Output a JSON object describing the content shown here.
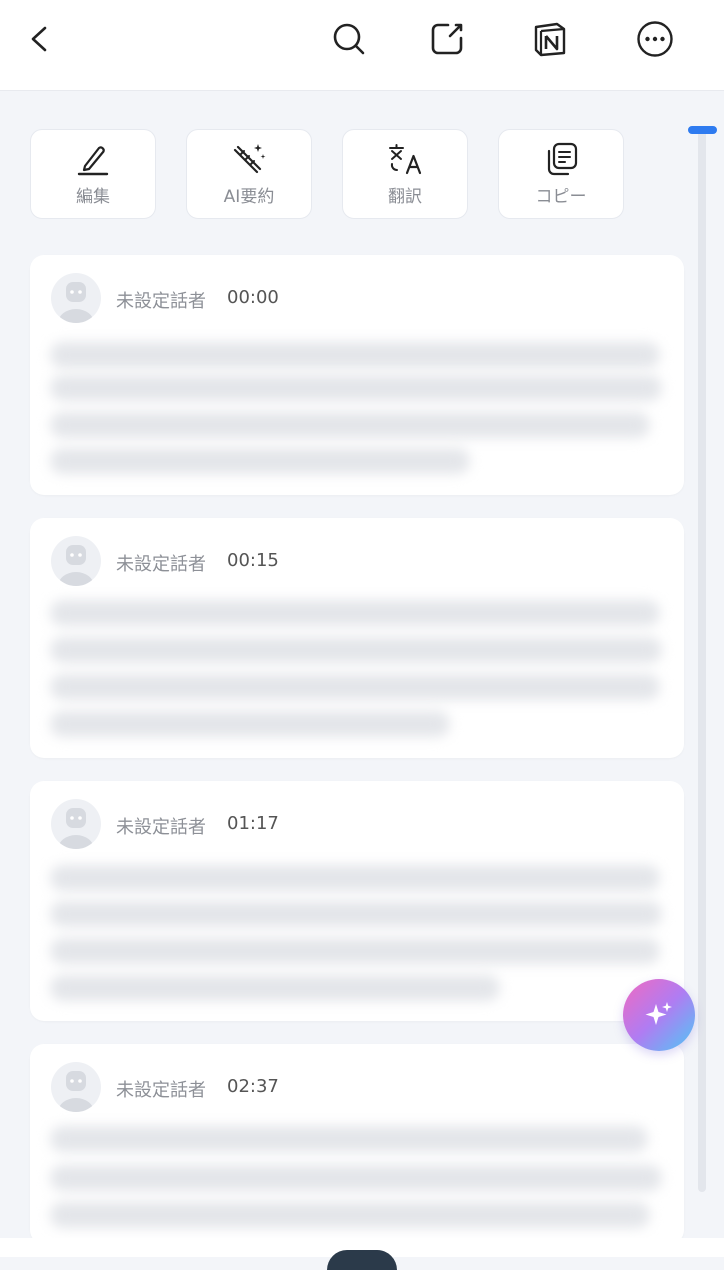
{
  "header": {
    "back_icon": "chevron-left-icon",
    "search_icon": "search-icon",
    "share_icon": "share-edit-icon",
    "notion_icon": "notion-icon",
    "more_icon": "more-horizontal-icon"
  },
  "actions": [
    {
      "label": "編集",
      "icon": "pencil-icon"
    },
    {
      "label": "AI要約",
      "icon": "magic-wand-icon"
    },
    {
      "label": "翻訳",
      "icon": "translate-icon"
    },
    {
      "label": "コピー",
      "icon": "copy-icon"
    }
  ],
  "transcripts": [
    {
      "speaker": "未設定話者",
      "time": "00:00"
    },
    {
      "speaker": "未設定話者",
      "time": "00:15"
    },
    {
      "speaker": "未設定話者",
      "time": "01:17"
    },
    {
      "speaker": "未設定話者",
      "time": "02:37"
    }
  ],
  "fab_icon": "sparkle-icon",
  "colors": {
    "accent": "#2e7bf0",
    "background": "#f3f5f9",
    "card": "#ffffff"
  }
}
